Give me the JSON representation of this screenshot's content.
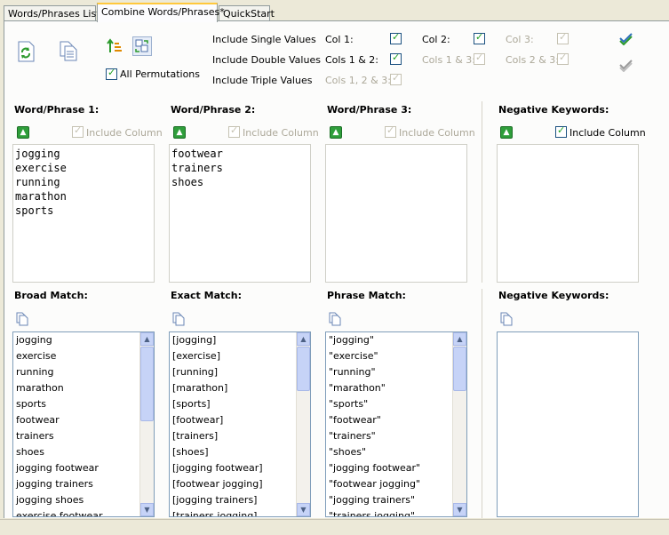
{
  "tabs": [
    {
      "label": "Words/Phrases List"
    },
    {
      "label": "Combine Words/Phrases*"
    },
    {
      "label": "QuickStart"
    }
  ],
  "toolbar": {
    "all_permutations": "All Permutations"
  },
  "options": {
    "include_single": "Include Single Values",
    "include_double": "Include Double Values",
    "include_triple": "Include Triple Values",
    "col1": "Col 1:",
    "col2": "Col 2:",
    "col3": "Col 3:",
    "cols12": "Cols 1 & 2:",
    "cols13": "Cols 1 & 3:",
    "cols23": "Cols 2 & 3:",
    "cols123": "Cols 1, 2 & 3:"
  },
  "inputs": {
    "wp1_title": "Word/Phrase 1:",
    "wp2_title": "Word/Phrase 2:",
    "wp3_title": "Word/Phrase 3:",
    "neg_title": "Negative Keywords:",
    "include_column": "Include Column",
    "wp1_text": "jogging\nexercise\nrunning\nmarathon\nsports",
    "wp2_text": "footwear\ntrainers\nshoes",
    "wp3_text": "",
    "neg_text": ""
  },
  "results": {
    "broad_title": "Broad Match:",
    "exact_title": "Exact Match:",
    "phrase_title": "Phrase Match:",
    "neg_title": "Negative Keywords:",
    "broad": [
      "jogging",
      "exercise",
      "running",
      "marathon",
      "sports",
      "footwear",
      "trainers",
      "shoes",
      "jogging footwear",
      "jogging trainers",
      "jogging shoes",
      "exercise footwear"
    ],
    "exact": [
      "[jogging]",
      "[exercise]",
      "[running]",
      "[marathon]",
      "[sports]",
      "[footwear]",
      "[trainers]",
      "[shoes]",
      "[jogging footwear]",
      "[footwear jogging]",
      "[jogging trainers]",
      "[trainers jogging]"
    ],
    "phrase": [
      "\"jogging\"",
      "\"exercise\"",
      "\"running\"",
      "\"marathon\"",
      "\"sports\"",
      "\"footwear\"",
      "\"trainers\"",
      "\"shoes\"",
      "\"jogging footwear\"",
      "\"footwear jogging\"",
      "\"jogging trainers\"",
      "\"trainers jogging\""
    ]
  }
}
